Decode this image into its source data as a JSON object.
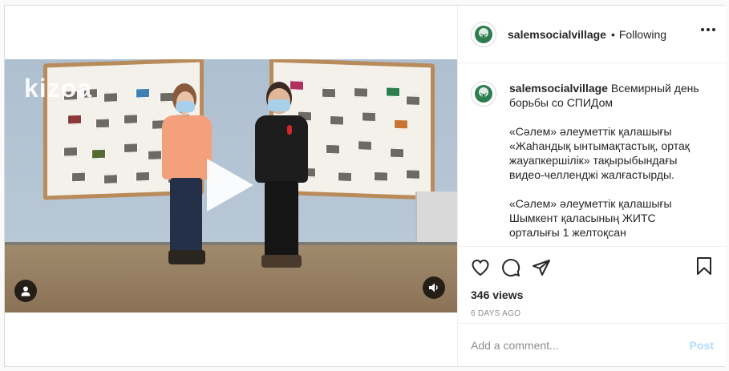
{
  "header": {
    "username": "salemsocialvillage",
    "separator": "•",
    "follow_status": "Following"
  },
  "caption": {
    "username": "salemsocialvillage",
    "title": "Всемирный день борьбы со СПИДом",
    "paragraph1": "«Сәлем» әлеуметтік қалашығы «Жаһандық ынтымақтастық, ортақ жауапкершілік» тақырыбындағы видео-челленджі жалғастырды.",
    "paragraph2": "«Сәлем» әлеуметтік қалашығы Шымкент қаласының ЖИТС орталығы 1 желтоқсан"
  },
  "video": {
    "watermark": "kizoa"
  },
  "stats": {
    "views": "346 views",
    "date": "6 DAYS AGO"
  },
  "comment": {
    "placeholder": "Add a comment...",
    "post_label": "Post"
  },
  "icons": {
    "like": "heart-icon",
    "comment": "comment-icon",
    "share": "paper-plane-icon",
    "save": "bookmark-icon",
    "more": "more-icon",
    "play": "play-icon",
    "user": "user-icon",
    "sound": "sound-icon"
  },
  "colors": {
    "accent_disabled": "#b3dbff",
    "muted": "#8e8e8e",
    "text": "#262626",
    "avatar_tree": "#2e7d4f"
  }
}
